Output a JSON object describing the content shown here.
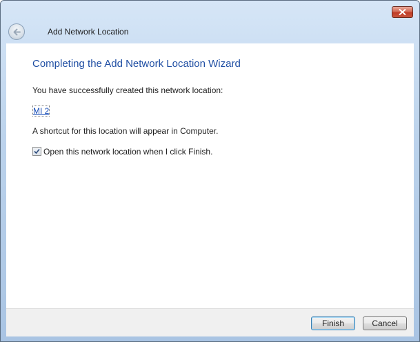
{
  "window": {
    "title": "Add Network Location",
    "close_icon": "close-icon",
    "back_icon": "back-arrow-icon"
  },
  "main": {
    "heading": "Completing the Add Network Location Wizard",
    "success_text": "You have successfully created this network location:",
    "location_name": "MI 2",
    "shortcut_text": "A shortcut for this location will appear in Computer.",
    "open_checkbox": {
      "label": "Open this network location when I click Finish.",
      "checked": true
    }
  },
  "footer": {
    "finish_label": "Finish",
    "cancel_label": "Cancel"
  },
  "colors": {
    "heading": "#1f4ea3",
    "link": "#1a4fb8",
    "close": "#c9553e"
  }
}
